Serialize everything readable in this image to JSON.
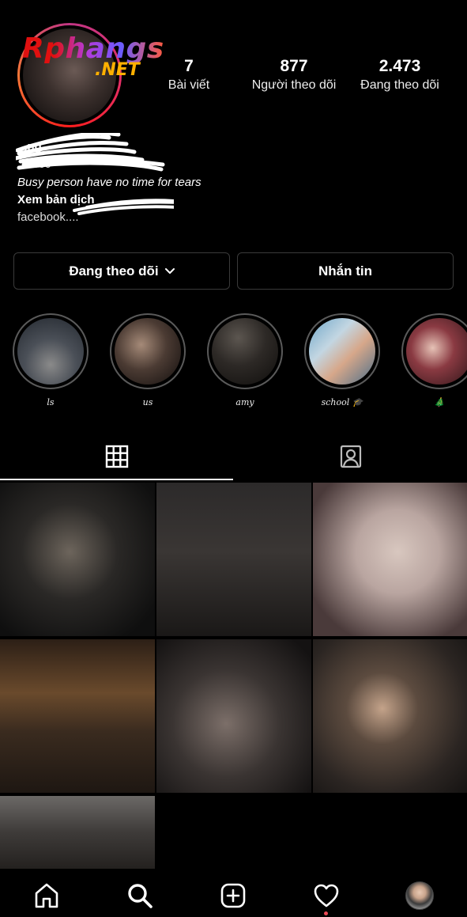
{
  "watermark": {
    "brand": "Rphangs",
    "suffix": ".NET"
  },
  "profile": {
    "stats": [
      {
        "value": "7",
        "label": "Bài viết"
      },
      {
        "value": "877",
        "label": "Người theo dõi"
      },
      {
        "value": "2.473",
        "label": "Đang theo dõi"
      }
    ],
    "name": "...ng",
    "handle": "...5999",
    "bio": "Busy person have no time for tears",
    "translate_label": "Xem bản dịch",
    "link": "facebook...."
  },
  "actions": {
    "following_label": "Đang theo dõi",
    "message_label": "Nhắn tin"
  },
  "highlights": [
    {
      "label": "ls"
    },
    {
      "label": "us"
    },
    {
      "label": "amy"
    },
    {
      "label": "school 🎓"
    },
    {
      "label": "🎄"
    }
  ],
  "tabs": [
    {
      "name": "grid-icon",
      "active": true
    },
    {
      "name": "tagged-icon",
      "active": false
    }
  ],
  "nav": [
    {
      "name": "home-icon"
    },
    {
      "name": "search-icon"
    },
    {
      "name": "add-post-icon"
    },
    {
      "name": "heart-icon"
    },
    {
      "name": "profile-icon"
    }
  ],
  "colors": {
    "background": "#000000",
    "border": "#3a3a3a",
    "notification_dot": "#ed4956"
  }
}
